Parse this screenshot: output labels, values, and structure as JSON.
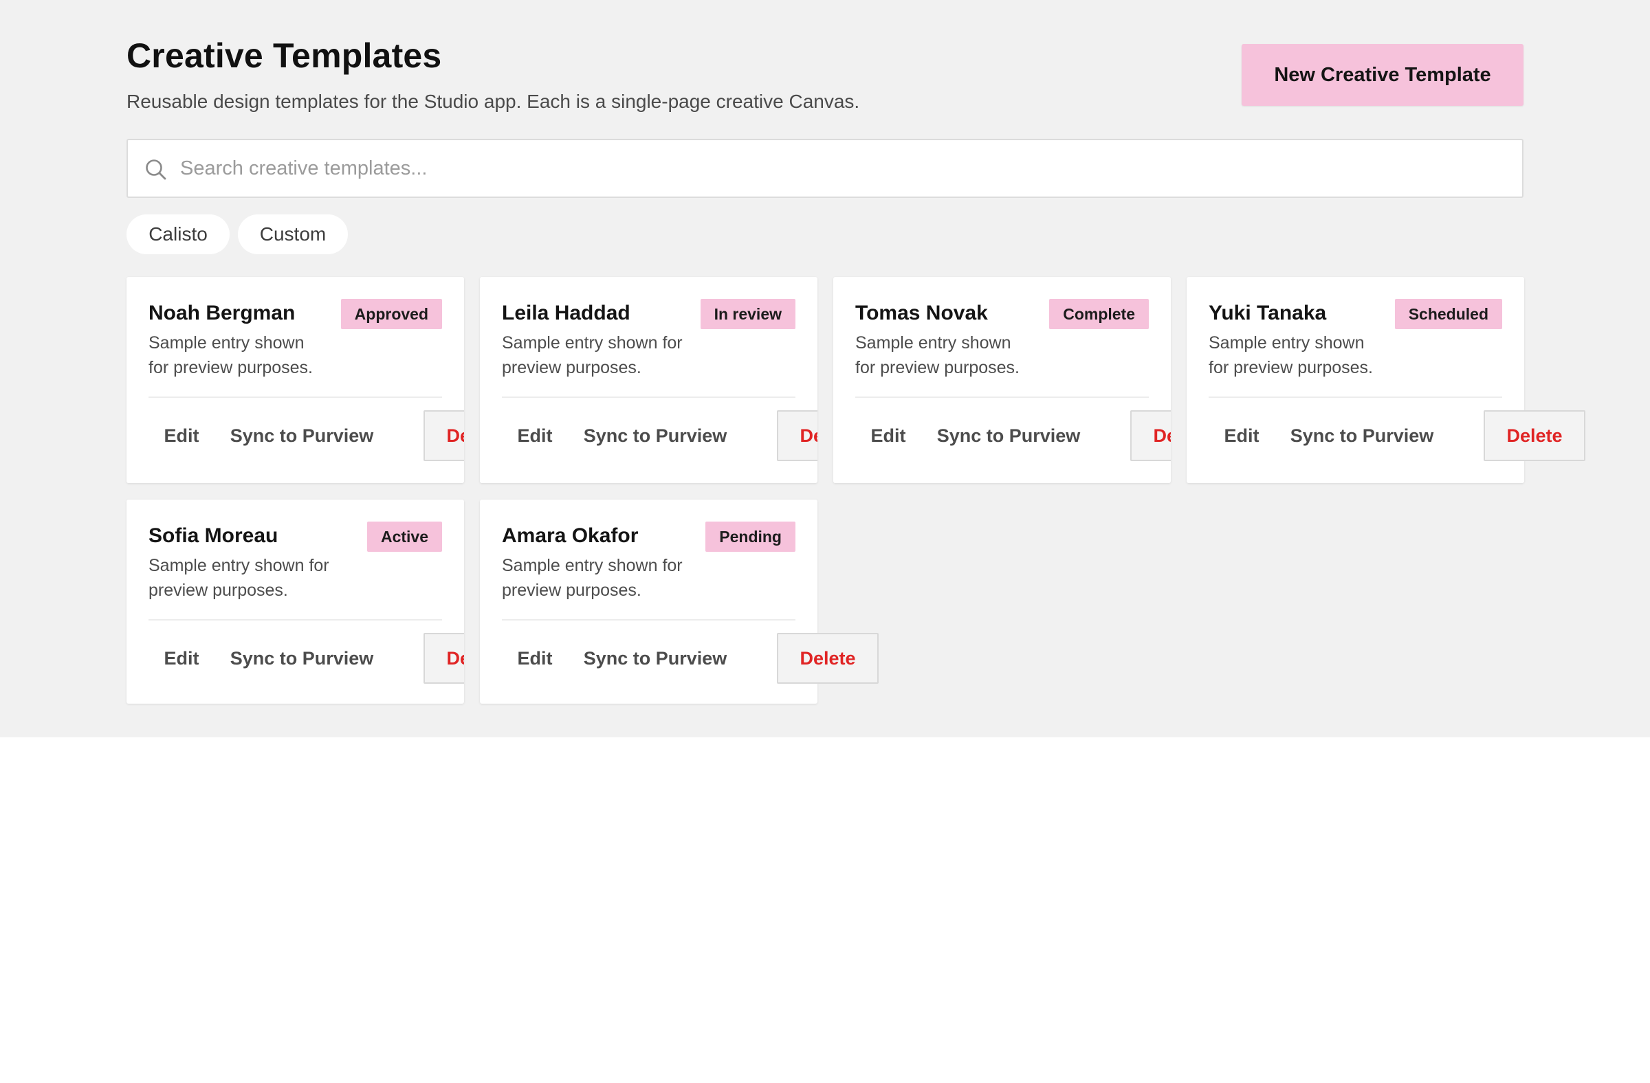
{
  "header": {
    "title": "Creative Templates",
    "subtitle": "Reusable design templates for the Studio app. Each is a single-page creative Canvas.",
    "new_button_label": "New Creative Template"
  },
  "search": {
    "placeholder": "Search creative templates...",
    "value": ""
  },
  "filters": [
    "Calisto",
    "Custom"
  ],
  "actions": {
    "edit": "Edit",
    "sync": "Sync to Purview",
    "delete": "Delete"
  },
  "cards": [
    {
      "name": "Noah Bergman",
      "status": "Approved",
      "desc_line1": "Sample entry shown",
      "desc_line2": "for preview purposes."
    },
    {
      "name": "Leila Haddad",
      "status": "In review",
      "desc_line1": "Sample entry shown for",
      "desc_line2": "preview purposes."
    },
    {
      "name": "Tomas Novak",
      "status": "Complete",
      "desc_line1": "Sample entry shown",
      "desc_line2": "for preview purposes."
    },
    {
      "name": "Yuki Tanaka",
      "status": "Scheduled",
      "desc_line1": "Sample entry shown",
      "desc_line2": "for preview purposes."
    },
    {
      "name": "Sofia Moreau",
      "status": "Active",
      "desc_line1": "Sample entry shown for",
      "desc_line2": "preview purposes."
    },
    {
      "name": "Amara Okafor",
      "status": "Pending",
      "desc_line1": "Sample entry shown for",
      "desc_line2": "preview purposes."
    }
  ],
  "colors": {
    "accent": "#f6c2db",
    "danger": "#e02424",
    "page_background": "#f1f1f1"
  }
}
